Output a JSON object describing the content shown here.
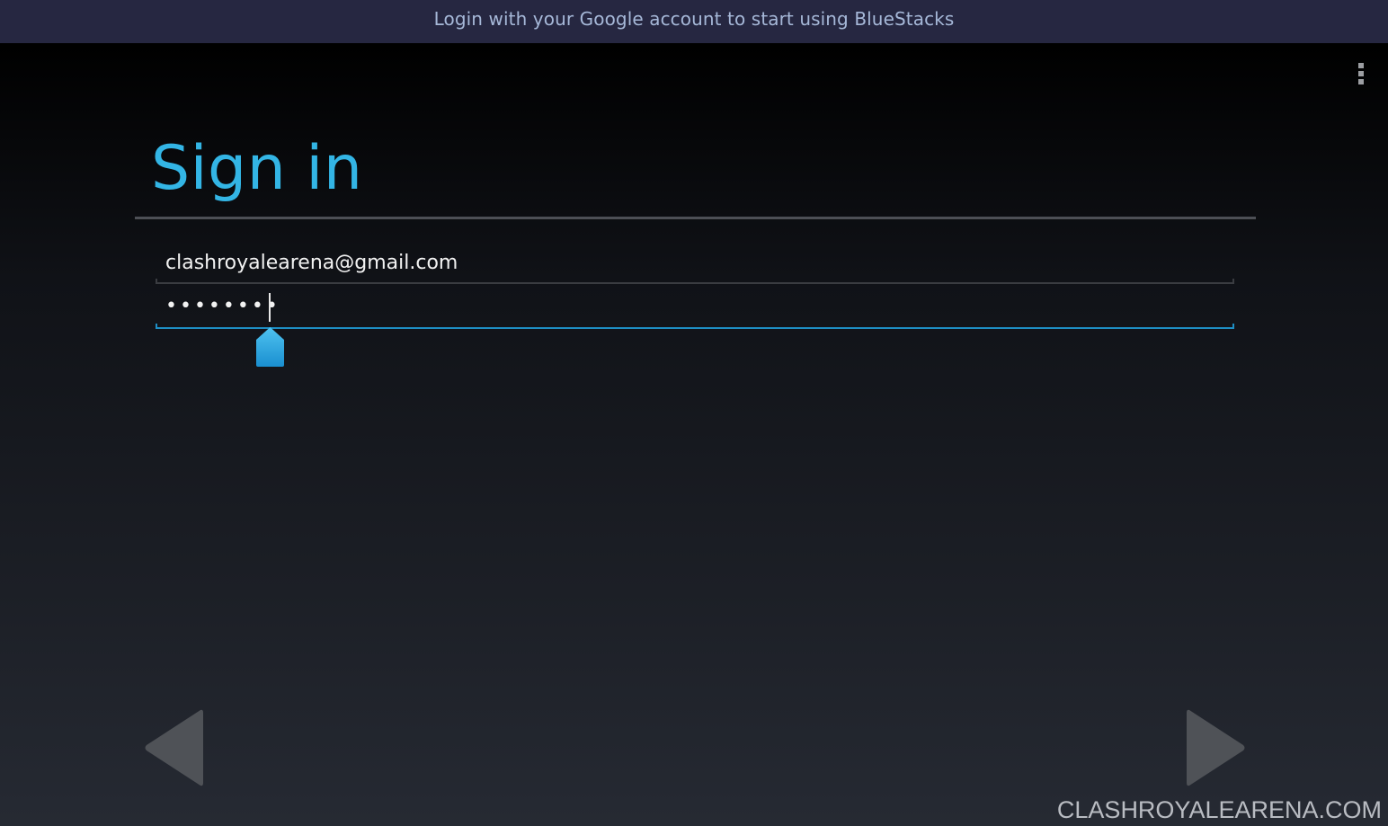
{
  "banner": {
    "text": "Login with your Google account to start using BlueStacks"
  },
  "signin": {
    "title": "Sign in",
    "email_value": "clashroyalearena@gmail.com",
    "password_value": "••••••••",
    "accent_color": "#33b5e5"
  },
  "icons": {
    "menu": "overflow-menu-icon",
    "back": "back-arrow-icon",
    "next": "next-arrow-icon",
    "handle": "text-cursor-handle-icon"
  },
  "watermark": {
    "text": "CLASHROYALEARENA.COM"
  }
}
